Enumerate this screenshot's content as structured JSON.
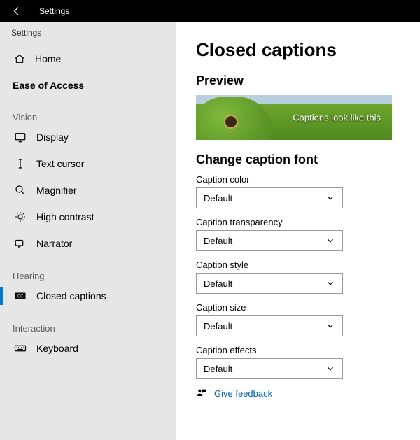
{
  "titlebar": {
    "title": "Settings"
  },
  "sidebar": {
    "appName": "Settings",
    "home": "Home",
    "category": "Ease of Access",
    "groups": {
      "vision": {
        "label": "Vision",
        "items": [
          "Display",
          "Text cursor",
          "Magnifier",
          "High contrast",
          "Narrator"
        ]
      },
      "hearing": {
        "label": "Hearing",
        "items": [
          "Closed captions"
        ]
      },
      "interaction": {
        "label": "Interaction",
        "items": [
          "Keyboard"
        ]
      }
    }
  },
  "main": {
    "title": "Closed captions",
    "previewHeading": "Preview",
    "previewCaption": "Captions look like this",
    "sectionHeading": "Change caption font",
    "fields": {
      "color": {
        "label": "Caption color",
        "value": "Default"
      },
      "transparency": {
        "label": "Caption transparency",
        "value": "Default"
      },
      "style": {
        "label": "Caption style",
        "value": "Default"
      },
      "size": {
        "label": "Caption size",
        "value": "Default"
      },
      "effects": {
        "label": "Caption effects",
        "value": "Default"
      }
    },
    "feedback": "Give feedback"
  }
}
